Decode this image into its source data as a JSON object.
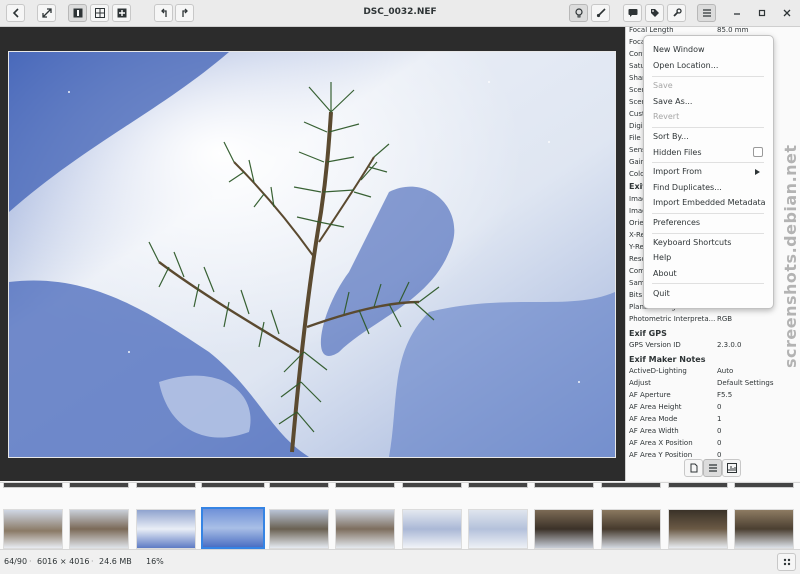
{
  "window": {
    "title": "DSC_0032.NEF"
  },
  "header": {
    "back_icon": "chevron-left-icon",
    "fullscreen_icon": "expand-icon",
    "view_single_icon": "single-view-icon",
    "view_grid_icon": "grid-view-icon",
    "view_compare_icon": "compare-view-icon",
    "rotate_left_icon": "rotate-left-icon",
    "rotate_right_icon": "rotate-right-icon",
    "light_icon": "bulb-icon",
    "edit_icon": "brush-icon",
    "comment_icon": "comment-icon",
    "tag_icon": "tag-icon",
    "tools_icon": "wrench-icon",
    "menu_icon": "hamburger-icon"
  },
  "properties": {
    "top_rows": [
      {
        "k": "Focal Length",
        "v": "85.0 mm"
      },
      {
        "k": "Focal",
        "v": ""
      },
      {
        "k": "Contr",
        "v": ""
      },
      {
        "k": "Satu",
        "v": ""
      },
      {
        "k": "Sharp",
        "v": ""
      },
      {
        "k": "Scen",
        "v": "aphed"
      },
      {
        "k": "Scen",
        "v": ""
      },
      {
        "k": "Cust",
        "v": ""
      },
      {
        "k": "Digi",
        "v": ""
      },
      {
        "k": "File",
        "v": "ra"
      },
      {
        "k": "Sens",
        "v": "rea"
      },
      {
        "k": "Gain",
        "v": ""
      },
      {
        "k": "Colo",
        "v": ""
      }
    ],
    "exif_section": "Exif",
    "exif_rows": [
      {
        "k": "Imag",
        "v": ""
      },
      {
        "k": "Imag",
        "v": ""
      },
      {
        "k": "Orie",
        "v": ""
      },
      {
        "k": "X-Re",
        "v": ""
      },
      {
        "k": "Y-Re",
        "v": ""
      },
      {
        "k": "Reso",
        "v": ""
      },
      {
        "k": "Com",
        "v": ""
      },
      {
        "k": "Sam",
        "v": ""
      },
      {
        "k": "Bits",
        "v": ""
      },
      {
        "k": "Planar Configuration",
        "v": "1"
      },
      {
        "k": "Photometric Interpreta...",
        "v": "RGB"
      }
    ],
    "gps_section": "Exif GPS",
    "gps_rows": [
      {
        "k": "GPS Version ID",
        "v": "2.3.0.0"
      }
    ],
    "maker_section": "Exif Maker Notes",
    "maker_rows": [
      {
        "k": "ActiveD-Lighting",
        "v": "Auto"
      },
      {
        "k": "Adjust",
        "v": "Default Settings"
      },
      {
        "k": "AF Aperture",
        "v": "F5.5"
      },
      {
        "k": "AF Area Height",
        "v": "0"
      },
      {
        "k": "AF Area Mode",
        "v": "1"
      },
      {
        "k": "AF Area Width",
        "v": "0"
      },
      {
        "k": "AF Area X Position",
        "v": "0"
      },
      {
        "k": "AF Area Y Position",
        "v": "0"
      }
    ]
  },
  "menu": {
    "new_window": "New Window",
    "open_location": "Open Location...",
    "save": "Save",
    "save_as": "Save As...",
    "revert": "Revert",
    "sort_by": "Sort By...",
    "hidden_files": "Hidden Files",
    "import_from": "Import From",
    "find_duplicates": "Find Duplicates...",
    "import_embedded": "Import Embedded Metadata",
    "preferences": "Preferences",
    "keyboard_shortcuts": "Keyboard Shortcuts",
    "help": "Help",
    "about": "About",
    "quit": "Quit"
  },
  "status": {
    "position": "64/90",
    "dimensions": "6016 × 4016",
    "size": "24.6 MB",
    "zoom": "16%"
  },
  "watermark": "screenshots.debian.net",
  "colors": {
    "accent": "#3584e4",
    "snow_shadow": "#4a6cc2"
  }
}
